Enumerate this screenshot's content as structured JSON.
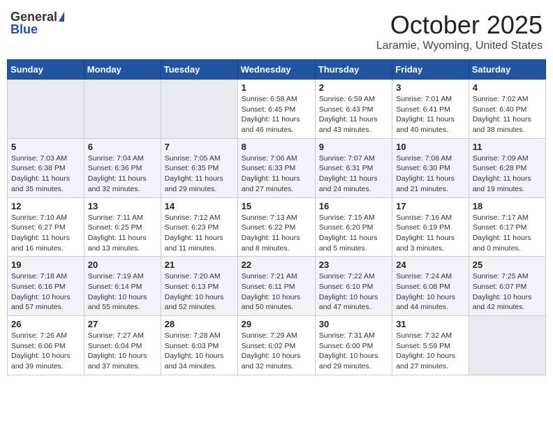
{
  "header": {
    "logo_general": "General",
    "logo_blue": "Blue",
    "month_title": "October 2025",
    "location": "Laramie, Wyoming, United States"
  },
  "weekdays": [
    "Sunday",
    "Monday",
    "Tuesday",
    "Wednesday",
    "Thursday",
    "Friday",
    "Saturday"
  ],
  "weeks": [
    [
      {
        "day": "",
        "info": ""
      },
      {
        "day": "",
        "info": ""
      },
      {
        "day": "",
        "info": ""
      },
      {
        "day": "1",
        "info": "Sunrise: 6:58 AM\nSunset: 6:45 PM\nDaylight: 11 hours\nand 46 minutes."
      },
      {
        "day": "2",
        "info": "Sunrise: 6:59 AM\nSunset: 6:43 PM\nDaylight: 11 hours\nand 43 minutes."
      },
      {
        "day": "3",
        "info": "Sunrise: 7:01 AM\nSunset: 6:41 PM\nDaylight: 11 hours\nand 40 minutes."
      },
      {
        "day": "4",
        "info": "Sunrise: 7:02 AM\nSunset: 6:40 PM\nDaylight: 11 hours\nand 38 minutes."
      }
    ],
    [
      {
        "day": "5",
        "info": "Sunrise: 7:03 AM\nSunset: 6:38 PM\nDaylight: 11 hours\nand 35 minutes."
      },
      {
        "day": "6",
        "info": "Sunrise: 7:04 AM\nSunset: 6:36 PM\nDaylight: 11 hours\nand 32 minutes."
      },
      {
        "day": "7",
        "info": "Sunrise: 7:05 AM\nSunset: 6:35 PM\nDaylight: 11 hours\nand 29 minutes."
      },
      {
        "day": "8",
        "info": "Sunrise: 7:06 AM\nSunset: 6:33 PM\nDaylight: 11 hours\nand 27 minutes."
      },
      {
        "day": "9",
        "info": "Sunrise: 7:07 AM\nSunset: 6:31 PM\nDaylight: 11 hours\nand 24 minutes."
      },
      {
        "day": "10",
        "info": "Sunrise: 7:08 AM\nSunset: 6:30 PM\nDaylight: 11 hours\nand 21 minutes."
      },
      {
        "day": "11",
        "info": "Sunrise: 7:09 AM\nSunset: 6:28 PM\nDaylight: 11 hours\nand 19 minutes."
      }
    ],
    [
      {
        "day": "12",
        "info": "Sunrise: 7:10 AM\nSunset: 6:27 PM\nDaylight: 11 hours\nand 16 minutes."
      },
      {
        "day": "13",
        "info": "Sunrise: 7:11 AM\nSunset: 6:25 PM\nDaylight: 11 hours\nand 13 minutes."
      },
      {
        "day": "14",
        "info": "Sunrise: 7:12 AM\nSunset: 6:23 PM\nDaylight: 11 hours\nand 11 minutes."
      },
      {
        "day": "15",
        "info": "Sunrise: 7:13 AM\nSunset: 6:22 PM\nDaylight: 11 hours\nand 8 minutes."
      },
      {
        "day": "16",
        "info": "Sunrise: 7:15 AM\nSunset: 6:20 PM\nDaylight: 11 hours\nand 5 minutes."
      },
      {
        "day": "17",
        "info": "Sunrise: 7:16 AM\nSunset: 6:19 PM\nDaylight: 11 hours\nand 3 minutes."
      },
      {
        "day": "18",
        "info": "Sunrise: 7:17 AM\nSunset: 6:17 PM\nDaylight: 11 hours\nand 0 minutes."
      }
    ],
    [
      {
        "day": "19",
        "info": "Sunrise: 7:18 AM\nSunset: 6:16 PM\nDaylight: 10 hours\nand 57 minutes."
      },
      {
        "day": "20",
        "info": "Sunrise: 7:19 AM\nSunset: 6:14 PM\nDaylight: 10 hours\nand 55 minutes."
      },
      {
        "day": "21",
        "info": "Sunrise: 7:20 AM\nSunset: 6:13 PM\nDaylight: 10 hours\nand 52 minutes."
      },
      {
        "day": "22",
        "info": "Sunrise: 7:21 AM\nSunset: 6:11 PM\nDaylight: 10 hours\nand 50 minutes."
      },
      {
        "day": "23",
        "info": "Sunrise: 7:22 AM\nSunset: 6:10 PM\nDaylight: 10 hours\nand 47 minutes."
      },
      {
        "day": "24",
        "info": "Sunrise: 7:24 AM\nSunset: 6:08 PM\nDaylight: 10 hours\nand 44 minutes."
      },
      {
        "day": "25",
        "info": "Sunrise: 7:25 AM\nSunset: 6:07 PM\nDaylight: 10 hours\nand 42 minutes."
      }
    ],
    [
      {
        "day": "26",
        "info": "Sunrise: 7:26 AM\nSunset: 6:06 PM\nDaylight: 10 hours\nand 39 minutes."
      },
      {
        "day": "27",
        "info": "Sunrise: 7:27 AM\nSunset: 6:04 PM\nDaylight: 10 hours\nand 37 minutes."
      },
      {
        "day": "28",
        "info": "Sunrise: 7:28 AM\nSunset: 6:03 PM\nDaylight: 10 hours\nand 34 minutes."
      },
      {
        "day": "29",
        "info": "Sunrise: 7:29 AM\nSunset: 6:02 PM\nDaylight: 10 hours\nand 32 minutes."
      },
      {
        "day": "30",
        "info": "Sunrise: 7:31 AM\nSunset: 6:00 PM\nDaylight: 10 hours\nand 29 minutes."
      },
      {
        "day": "31",
        "info": "Sunrise: 7:32 AM\nSunset: 5:59 PM\nDaylight: 10 hours\nand 27 minutes."
      },
      {
        "day": "",
        "info": ""
      }
    ]
  ]
}
